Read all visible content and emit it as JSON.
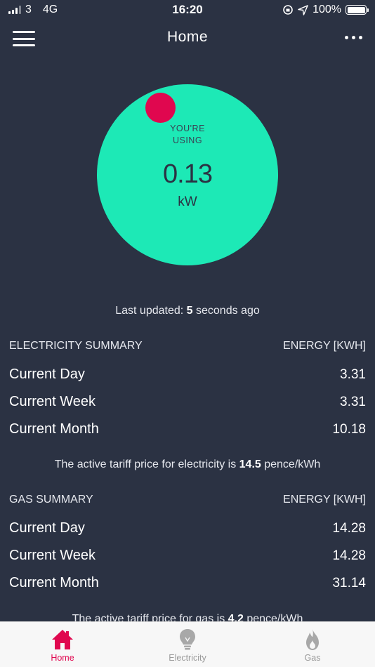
{
  "status_bar": {
    "carrier": "3",
    "network": "4G",
    "time": "16:20",
    "battery": "100%"
  },
  "nav": {
    "title": "Home",
    "menu_icon": "hamburger-icon",
    "more_icon": "ellipsis-icon"
  },
  "usage": {
    "label_line1": "YOU'RE",
    "label_line2": "USING",
    "value": "0.13",
    "unit": "kW"
  },
  "last_updated": {
    "prefix": "Last updated: ",
    "value": "5",
    "suffix": " seconds ago"
  },
  "electricity_summary": {
    "title": "ELECTRICITY SUMMARY",
    "column": "ENERGY [KWH]",
    "rows": [
      {
        "label": "Current Day",
        "value": "3.31"
      },
      {
        "label": "Current Week",
        "value": "3.31"
      },
      {
        "label": "Current Month",
        "value": "10.18"
      }
    ],
    "tariff_prefix": "The active tariff price for electricity is ",
    "tariff_value": "14.5",
    "tariff_suffix": " pence/kWh"
  },
  "gas_summary": {
    "title": "GAS SUMMARY",
    "column": "ENERGY [KWH]",
    "rows": [
      {
        "label": "Current Day",
        "value": "14.28"
      },
      {
        "label": "Current Week",
        "value": "14.28"
      },
      {
        "label": "Current Month",
        "value": "31.14"
      }
    ],
    "tariff_prefix": "The active tariff price for gas is ",
    "tariff_value": "4.2",
    "tariff_suffix": " pence/kWh"
  },
  "tabs": [
    {
      "label": "Home",
      "icon": "house-icon",
      "active": true
    },
    {
      "label": "Electricity",
      "icon": "lightbulb-icon",
      "active": false
    },
    {
      "label": "Gas",
      "icon": "flame-icon",
      "active": false
    }
  ],
  "colors": {
    "background": "#2b3243",
    "usage_circle": "#1de9b6",
    "accent": "#e0074f"
  }
}
